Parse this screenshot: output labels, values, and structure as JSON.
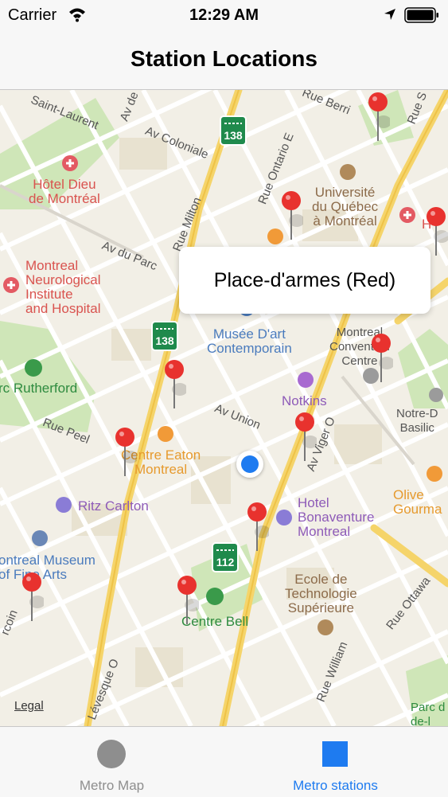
{
  "status": {
    "carrier": "Carrier",
    "time": "12:29 AM"
  },
  "nav": {
    "title": "Station Locations"
  },
  "map": {
    "callout": "Place-d'armes (Red)",
    "legal": "Legal",
    "highways": [
      "138",
      "138",
      "112"
    ],
    "streets": [
      "Rue Berri",
      "Saint-Laurent",
      "Av de",
      "Av Coloniale",
      "Rue Ontario E",
      "Rue Milton",
      "Av du Parc",
      "Av Union",
      "Av Viger O",
      "Rue Peel",
      "Rue Ottawa",
      "Rue William",
      "Lévesque O",
      "rcoin",
      "Rue S"
    ],
    "pois": {
      "hotel_dieu": "Hôtel Dieu\nde Montréal",
      "uqam": "Université\ndu Québec\nà Montréal",
      "neuro": "Montreal\nNeurological\nInstitute\nand Hospital",
      "musee": "Musée D'art\nContemporain",
      "convention": "Montreal\nConvention\nCentre",
      "parc": "rc Rutherford",
      "notkins": "Notkins",
      "notre_dame": "Notre-D\nBasilic",
      "eaton": "Centre Eaton\nMontreal",
      "ritz": "Ritz Carlton",
      "bonaventure": "Hotel\nBonaventure\nMontreal",
      "olive": "Olive\nGourma",
      "museum": "ontreal Museum\nof Fine Arts",
      "ecole": "Ecole de\nTechnologie\nSupérieure",
      "bell": "Centre Bell",
      "parc_de": "Parc d\nde-l",
      "h_right": "H"
    }
  },
  "tabs": [
    {
      "label": "Metro Map",
      "icon": "circle-icon"
    },
    {
      "label": "Metro stations",
      "icon": "square-icon"
    }
  ],
  "colors": {
    "accent": "#1e7bf0",
    "inactive": "#8e8e8e",
    "pin": "#e8322e"
  }
}
